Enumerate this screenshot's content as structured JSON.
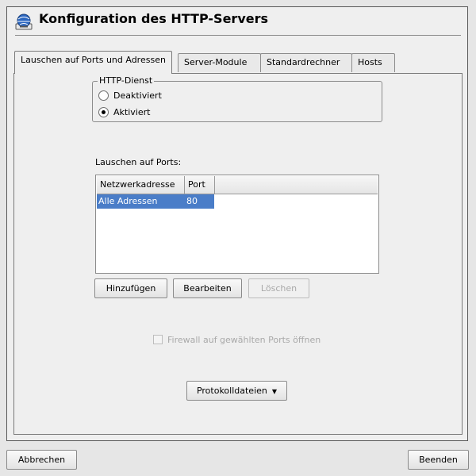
{
  "window": {
    "title": "Konfiguration des HTTP-Servers",
    "icon": "server-globe-icon"
  },
  "tabs": [
    {
      "label": "Lauschen auf Ports und Adressen",
      "active": true
    },
    {
      "label": "Server-Module",
      "active": false
    },
    {
      "label": "Standardrechner",
      "active": false
    },
    {
      "label": "Hosts",
      "active": false
    }
  ],
  "http_service": {
    "legend": "HTTP-Dienst",
    "options": [
      {
        "label": "Deaktiviert",
        "checked": false
      },
      {
        "label": "Aktiviert",
        "checked": true
      }
    ]
  },
  "ports": {
    "label": "Lauschen auf Ports:",
    "columns": [
      "Netzwerkadresse",
      "Port"
    ],
    "rows": [
      {
        "address": "Alle Adressen",
        "port": "80",
        "selected": true
      }
    ]
  },
  "actions": {
    "add": "Hinzufügen",
    "edit": "Bearbeiten",
    "delete": "Löschen"
  },
  "firewall": {
    "label": "Firewall auf gewählten Ports öffnen",
    "checked": false,
    "disabled": true
  },
  "logs_button": "Protokolldateien",
  "footer": {
    "cancel": "Abbrechen",
    "finish": "Beenden"
  },
  "colors": {
    "selection": "#4a7dc8",
    "background": "#efefef"
  }
}
